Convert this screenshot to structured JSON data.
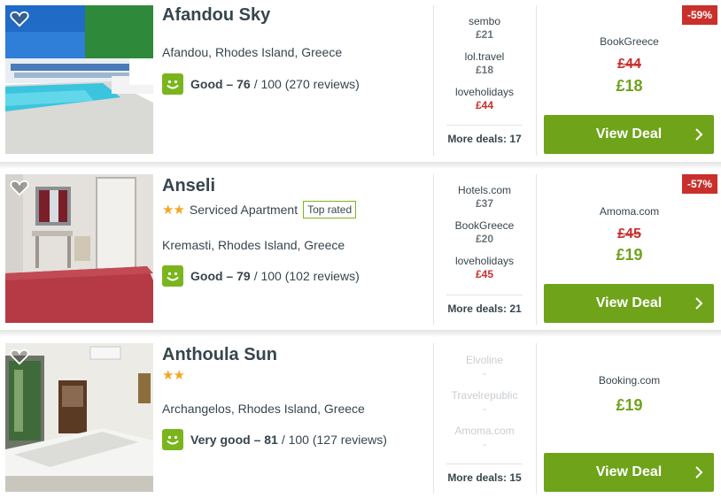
{
  "colors": {
    "accent_green": "#6ea31a",
    "discount_red": "#c9302c",
    "star_orange": "#f5a623"
  },
  "hotels": [
    {
      "name": "Afandou Sky",
      "stars": "",
      "type": "",
      "badge": "",
      "location": "Afandou, Rhodes Island, Greece",
      "rating_label": "Good – 76",
      "rating_rest": "/ 100 (270 reviews)",
      "deals": [
        {
          "site": "sembo",
          "price": "£21"
        },
        {
          "site": "lol.travel",
          "price": "£18"
        },
        {
          "site": "loveholidays",
          "price": "£44"
        }
      ],
      "more_deals": "More deals: 17",
      "discount": "-59%",
      "best_provider": "BookGreece",
      "old_price": "£44",
      "best_price": "£18",
      "cta": "View Deal"
    },
    {
      "name": "Anseli",
      "stars": "★★",
      "type": "Serviced Apartment",
      "badge": "Top rated",
      "location": "Kremasti, Rhodes Island, Greece",
      "rating_label": "Good – 79",
      "rating_rest": "/ 100 (102 reviews)",
      "deals": [
        {
          "site": "Hotels.com",
          "price": "£37"
        },
        {
          "site": "BookGreece",
          "price": "£20"
        },
        {
          "site": "loveholidays",
          "price": "£45"
        }
      ],
      "more_deals": "More deals: 21",
      "discount": "-57%",
      "best_provider": "Amoma.com",
      "old_price": "£45",
      "best_price": "£19",
      "cta": "View Deal"
    },
    {
      "name": "Anthoula Sun",
      "stars": "★★",
      "type": "",
      "badge": "",
      "location": "Archangelos, Rhodes Island, Greece",
      "rating_label": "Very good – 81",
      "rating_rest": "/ 100 (127 reviews)",
      "deals": [
        {
          "site": "Elvoline",
          "price": "-"
        },
        {
          "site": "Travelrepublic",
          "price": "-"
        },
        {
          "site": "Amoma.com",
          "price": "-"
        }
      ],
      "more_deals": "More deals: 15",
      "discount": "",
      "best_provider": "Booking.com",
      "old_price": "",
      "best_price": "£19",
      "cta": "View Deal"
    }
  ]
}
